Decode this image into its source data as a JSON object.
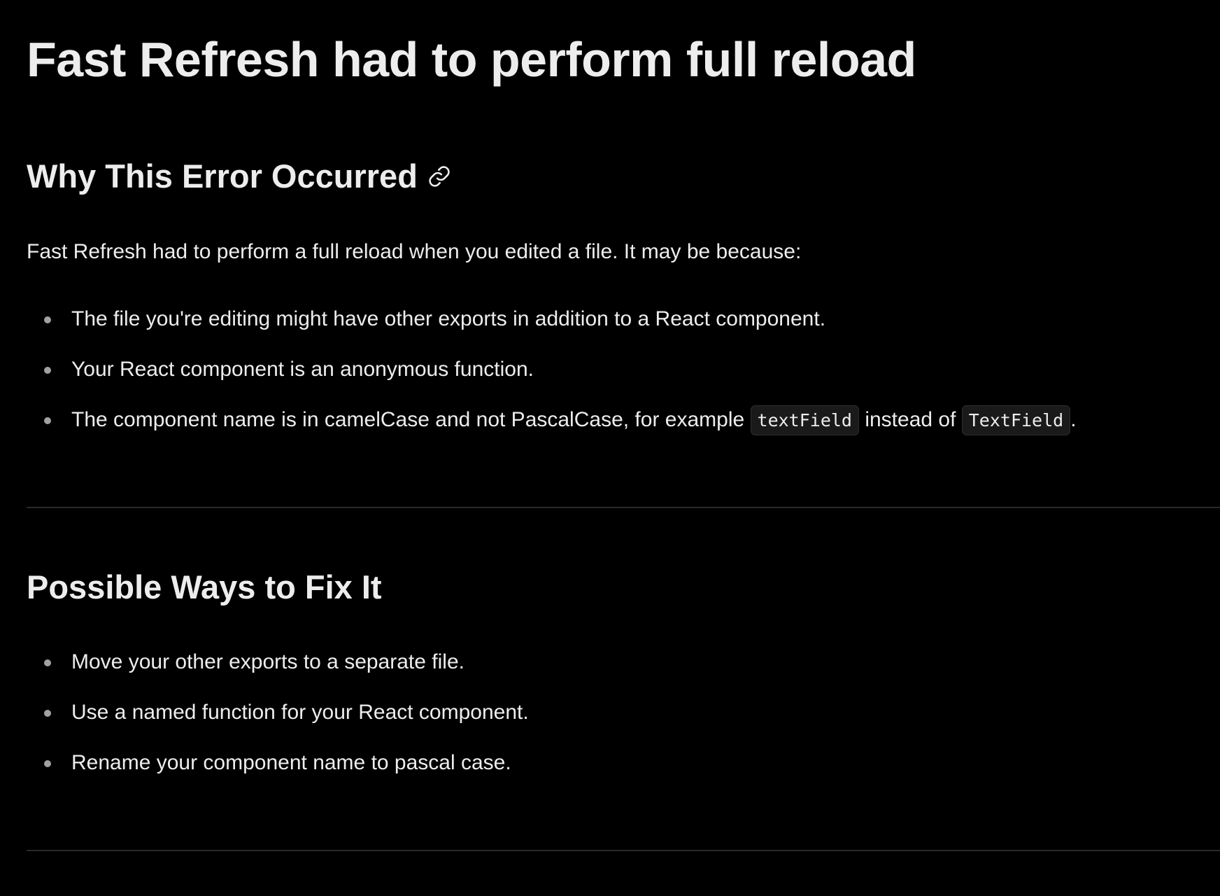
{
  "title": "Fast Refresh had to perform full reload",
  "why_section": {
    "heading": "Why This Error Occurred",
    "anchor_icon": "link-icon",
    "intro": "Fast Refresh had to perform a full reload when you edited a file. It may be because:",
    "items": [
      {
        "text": "The file you're editing might have other exports in addition to a React component."
      },
      {
        "text": "Your React component is an anonymous function."
      },
      {
        "text_before": "The component name is in camelCase and not PascalCase, for example ",
        "code_1": "textField",
        "text_middle": " instead of ",
        "code_2": "TextField",
        "text_after": "."
      }
    ]
  },
  "fix_section": {
    "heading": "Possible Ways to Fix It",
    "items": [
      {
        "text": "Move your other exports to a separate file."
      },
      {
        "text": "Use a named function for your React component."
      },
      {
        "text": "Rename your component name to pascal case."
      }
    ]
  },
  "colors": {
    "background": "#000000",
    "text": "#ededed",
    "bullet": "#a1a1a1",
    "divider": "#2a2a2a",
    "code_background": "#1a1a1a"
  }
}
